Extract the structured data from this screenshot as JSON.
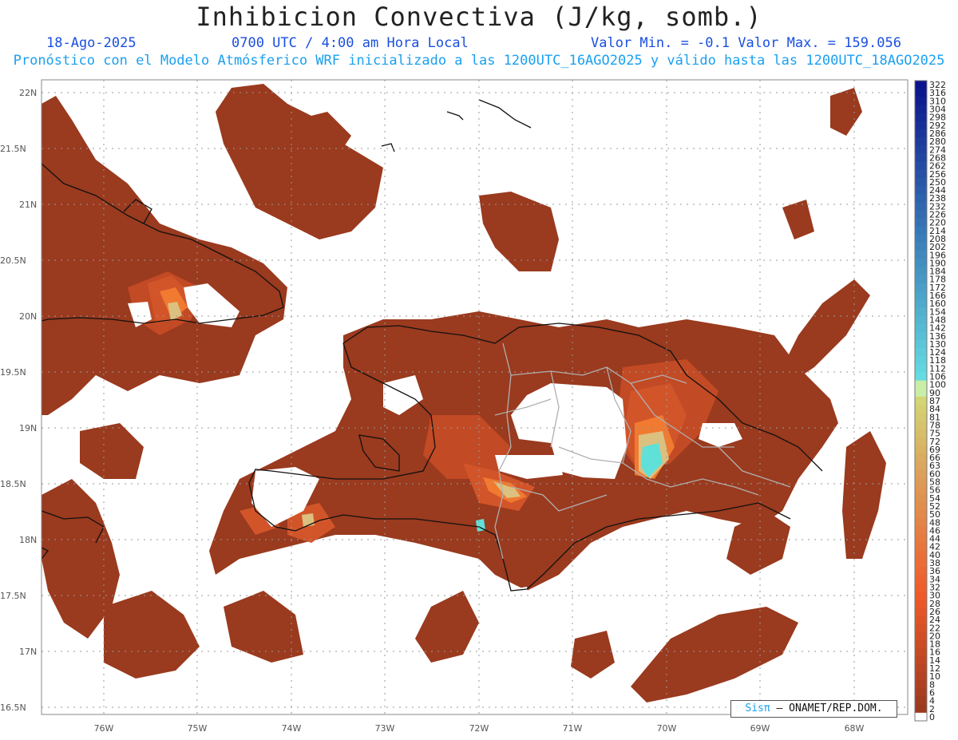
{
  "title": "Inhibicion Convectiva (J/kg, somb.)",
  "header": {
    "date": "18-Ago-2025",
    "time": "0700 UTC / 4:00 am Hora Local",
    "minmax": "Valor Min. = -0.1  Valor Max. = 159.056",
    "forecast": "Pronóstico con el Modelo Atmósferico WRF inicializado a las 1200UTC_16AGO2025 y válido hasta las  1200UTC_18AGO2025"
  },
  "axes": {
    "lat_labels": [
      "22N",
      "21.5N",
      "21N",
      "20.5N",
      "20N",
      "19.5N",
      "19N",
      "18.5N",
      "18N",
      "17.5N",
      "17N",
      "16.5N"
    ],
    "lon_labels": [
      "76W",
      "75W",
      "74W",
      "73W",
      "72W",
      "71W",
      "70W",
      "69W",
      "68W"
    ]
  },
  "colorbar": {
    "labels": [
      "322",
      "316",
      "310",
      "304",
      "298",
      "292",
      "286",
      "280",
      "274",
      "268",
      "262",
      "256",
      "250",
      "244",
      "238",
      "232",
      "226",
      "220",
      "214",
      "208",
      "202",
      "196",
      "190",
      "184",
      "178",
      "172",
      "166",
      "160",
      "154",
      "148",
      "142",
      "136",
      "130",
      "124",
      "118",
      "112",
      "106",
      "100",
      "90",
      "87",
      "84",
      "81",
      "78",
      "75",
      "72",
      "69",
      "66",
      "63",
      "60",
      "58",
      "56",
      "54",
      "52",
      "50",
      "48",
      "46",
      "44",
      "42",
      "40",
      "38",
      "36",
      "34",
      "32",
      "30",
      "28",
      "26",
      "24",
      "22",
      "20",
      "18",
      "16",
      "14",
      "12",
      "10",
      "8",
      "6",
      "4",
      "2",
      "0"
    ]
  },
  "credit": {
    "brand": "Sisπ",
    "text": "– ONAMET/REP.DOM."
  },
  "colors": {
    "field_base": "#9a3a1e",
    "field_mid": "#d2552a",
    "field_hot": "#f07a30",
    "field_light": "#dcc080",
    "field_cyan": "#5fe0d8",
    "grid": "#9a9a9a",
    "coast": "#111111",
    "border": "#b0b0b0"
  }
}
